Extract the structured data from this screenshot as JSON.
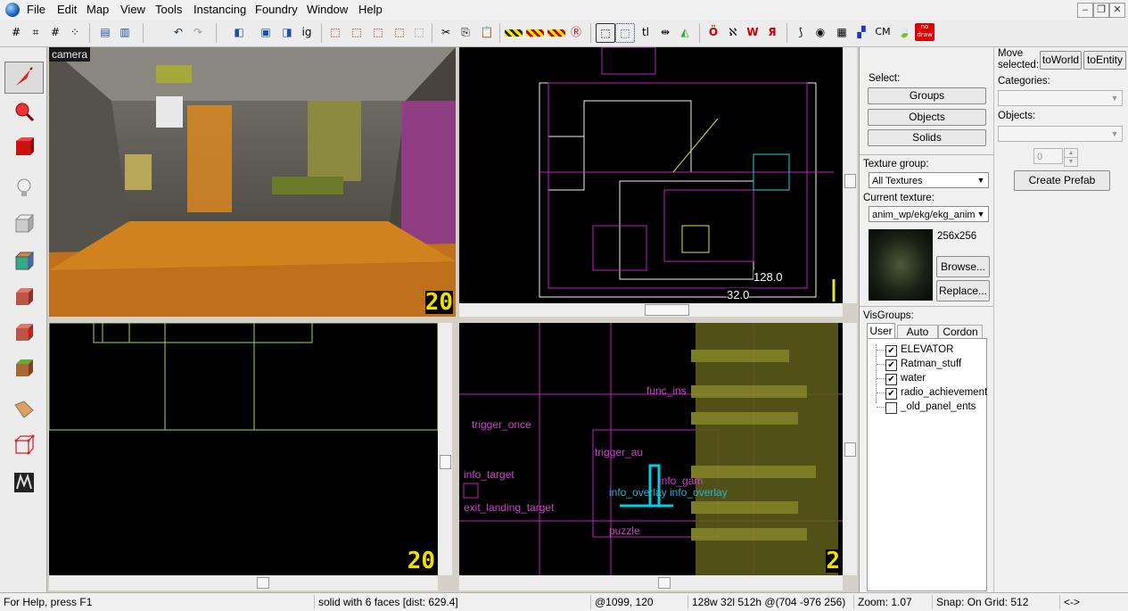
{
  "menu": [
    "File",
    "Edit",
    "Map",
    "View",
    "Tools",
    "Instancing",
    "Foundry",
    "Window",
    "Help"
  ],
  "toolbar": {
    "cm_label": "CM",
    "nodraw_label": "no draw"
  },
  "viewports": {
    "camera": {
      "label": "camera",
      "grid": "20"
    },
    "top": {
      "readout_a": "128.0",
      "readout_b": "32.0"
    },
    "front": {
      "grid": "20"
    },
    "side": {
      "grid": "2"
    },
    "entity_labels": [
      "trigger_once",
      "info_target",
      "exit_landing_target",
      "func_ins",
      "trigger_au",
      "info_overlay",
      "puzzle",
      "info_gam",
      "info_overlay"
    ]
  },
  "select_panel": {
    "title": "Select:",
    "groups": "Groups",
    "objects": "Objects",
    "solids": "Solids"
  },
  "texture_panel": {
    "group_label": "Texture group:",
    "group_value": "All Textures",
    "current_label": "Current texture:",
    "current_value": "anim_wp/ekg/ekg_anim",
    "size": "256x256",
    "browse": "Browse...",
    "replace": "Replace..."
  },
  "visgroups": {
    "title": "VisGroups:",
    "tabs": [
      "User",
      "Auto",
      "Cordon"
    ],
    "items": [
      {
        "name": "ELEVATOR",
        "checked": true
      },
      {
        "name": "Ratman_stuff",
        "checked": true
      },
      {
        "name": "water",
        "checked": true
      },
      {
        "name": "radio_achievement",
        "checked": true
      },
      {
        "name": "_old_panel_ents",
        "checked": false
      }
    ]
  },
  "move_panel": {
    "title": "Move selected:",
    "to_world": "toWorld",
    "to_entity": "toEntity",
    "categories_label": "Categories:",
    "objects_label": "Objects:",
    "spin_value": "0",
    "create_prefab": "Create Prefab"
  },
  "status": {
    "help": "For Help, press F1",
    "selection": "solid with 6 faces   [dist: 629.4]",
    "coords": "@1099, 120",
    "size": "128w 32l 512h @(704 -976 256)",
    "zoom": "Zoom: 1.07",
    "snap": "Snap: On Grid: 512",
    "extra": "<->"
  },
  "colors": {
    "accent_select": "#f0e000",
    "wire_yellow": "#e8e84a",
    "wire_magenta": "#d030d0",
    "wire_cyan": "#00d0e0",
    "ui_bg": "#f0f0f0"
  }
}
